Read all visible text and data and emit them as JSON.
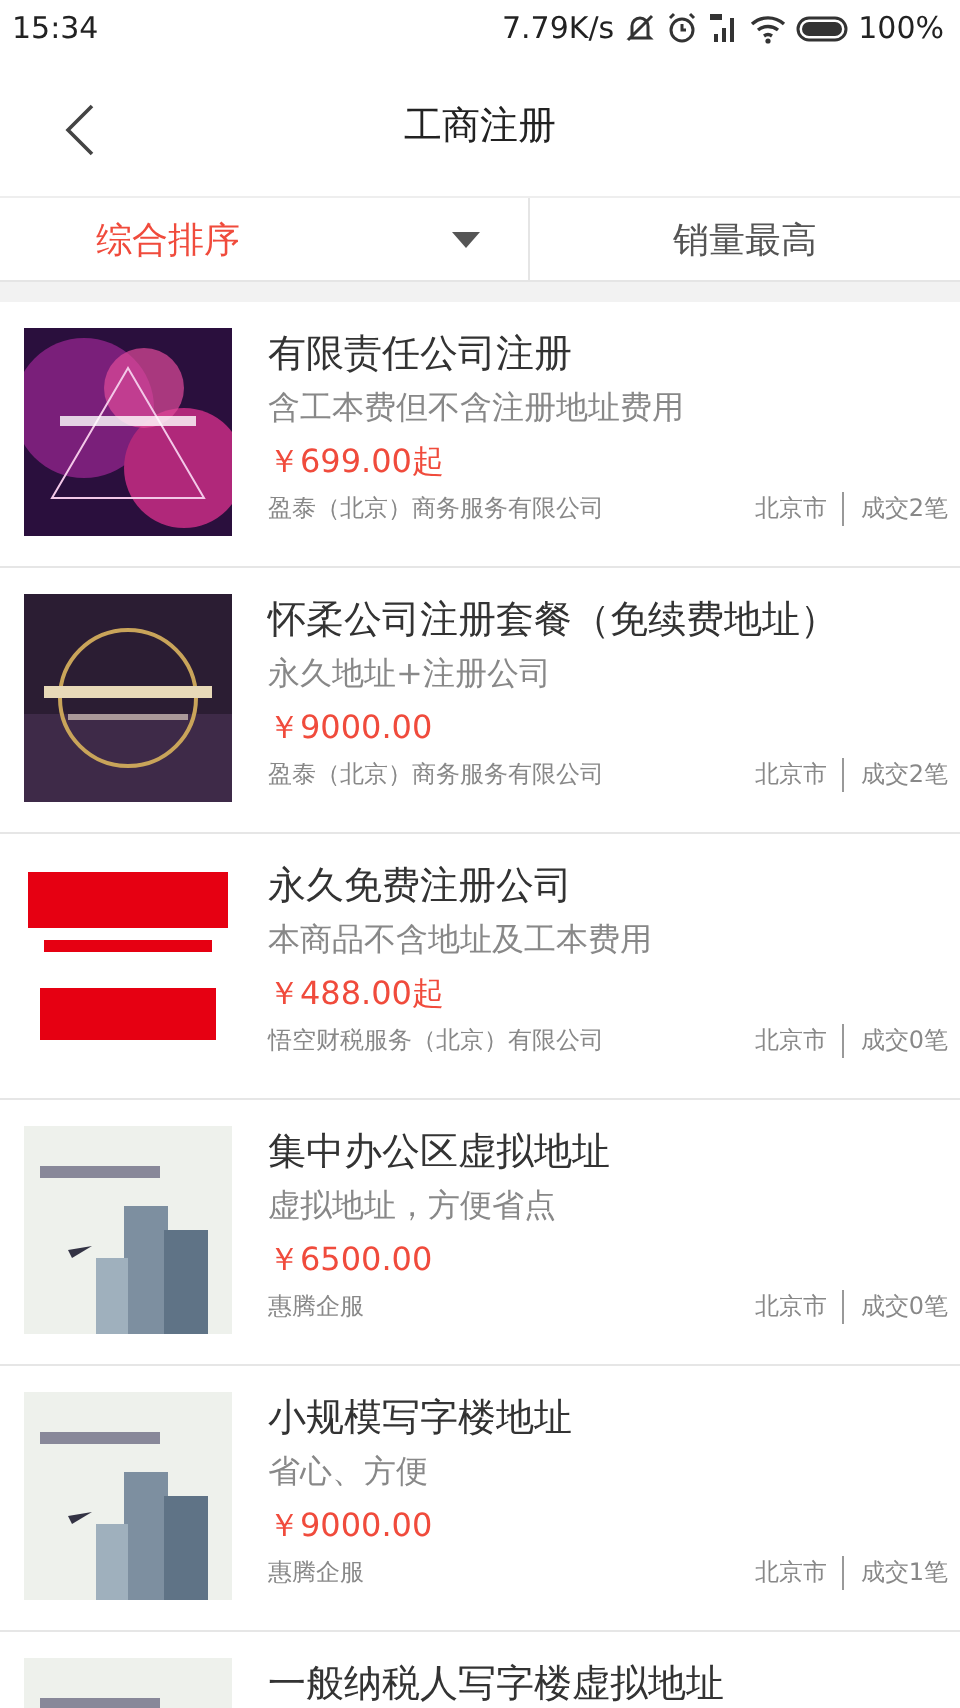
{
  "status_bar": {
    "time": "15:34",
    "speed": "7.79K/s",
    "battery": "100%"
  },
  "nav": {
    "title": "工商注册"
  },
  "sort_tabs": [
    {
      "label": "综合排序",
      "selected": true,
      "dropdown": true
    },
    {
      "label": "销量最高",
      "selected": false,
      "dropdown": false
    }
  ],
  "products": [
    {
      "title": "有限责任公司注册",
      "subtitle": "含工本费但不含注册地址费用",
      "price": "￥699.00起",
      "seller": "盈泰（北京）商务服务有限公司",
      "city": "北京市",
      "deals": "成交2笔"
    },
    {
      "title": "怀柔公司注册套餐（免续费地址）",
      "subtitle": "永久地址+注册公司",
      "price": "￥9000.00",
      "seller": "盈泰（北京）商务服务有限公司",
      "city": "北京市",
      "deals": "成交2笔"
    },
    {
      "title": "永久免费注册公司",
      "subtitle": "本商品不含地址及工本费用",
      "price": "￥488.00起",
      "seller": "悟空财税服务（北京）有限公司",
      "city": "北京市",
      "deals": "成交0笔"
    },
    {
      "title": "集中办公区虚拟地址",
      "subtitle": "虚拟地址，方便省点",
      "price": "￥6500.00",
      "seller": "惠腾企服",
      "city": "北京市",
      "deals": "成交0笔"
    },
    {
      "title": "小规模写字楼地址",
      "subtitle": "省心、方便",
      "price": "￥9000.00",
      "seller": "惠腾企服",
      "city": "北京市",
      "deals": "成交1笔"
    },
    {
      "title": "一般纳税人写字楼虚拟地址"
    }
  ]
}
